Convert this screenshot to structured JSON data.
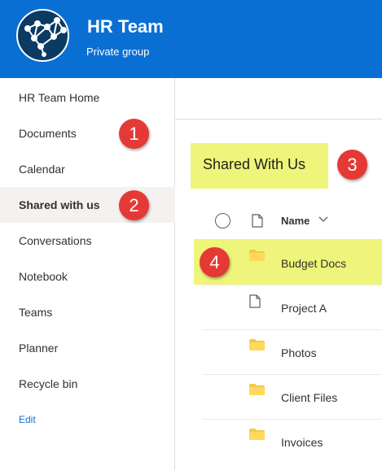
{
  "header": {
    "title": "HR Team",
    "subtitle": "Private group",
    "bg_color": "#0a6fd3",
    "logo_icon": "network-nodes-icon"
  },
  "sidebar": {
    "items": [
      {
        "label": "HR Team Home",
        "selected": false
      },
      {
        "label": "Documents",
        "selected": false
      },
      {
        "label": "Calendar",
        "selected": false
      },
      {
        "label": "Shared with us",
        "selected": true
      },
      {
        "label": "Conversations",
        "selected": false
      },
      {
        "label": "Notebook",
        "selected": false
      },
      {
        "label": "Teams",
        "selected": false
      },
      {
        "label": "Planner",
        "selected": false
      },
      {
        "label": "Recycle bin",
        "selected": false
      }
    ],
    "edit_label": "Edit"
  },
  "main": {
    "title": "Shared With Us",
    "column_name": "Name",
    "files": [
      {
        "name": "Budget Docs",
        "type": "folder",
        "icon": "folder-icon"
      },
      {
        "name": "Project A",
        "type": "file",
        "icon": "document-icon"
      },
      {
        "name": "Photos",
        "type": "folder",
        "icon": "folder-icon"
      },
      {
        "name": "Client Files",
        "type": "folder",
        "icon": "folder-icon"
      },
      {
        "name": "Invoices",
        "type": "folder",
        "icon": "folder-icon"
      }
    ]
  },
  "callouts": [
    "1",
    "2",
    "3",
    "4"
  ],
  "colors": {
    "highlight": "#eef57a",
    "callout": "#e53935",
    "folder": "#ffd85c",
    "accent": "#0a6fd3"
  }
}
